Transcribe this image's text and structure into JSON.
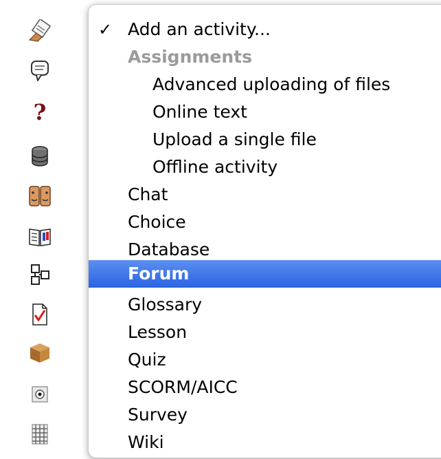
{
  "icons": [
    "assignment-icon",
    "chat-icon",
    "choice-icon",
    "database-icon",
    "forum-icon",
    "glossary-icon",
    "lesson-icon",
    "quiz-icon",
    "scorm-icon",
    "survey-icon",
    "wiki-icon"
  ],
  "menu": {
    "checkmark": "✓",
    "items": [
      {
        "label": "Add an activity..."
      },
      {
        "label": "Assignments"
      },
      {
        "label": "Advanced uploading of files"
      },
      {
        "label": "Online text"
      },
      {
        "label": "Upload a single file"
      },
      {
        "label": "Offline activity"
      },
      {
        "label": "Chat"
      },
      {
        "label": "Choice"
      },
      {
        "label": "Database"
      },
      {
        "label": "Forum"
      },
      {
        "label": "Glossary"
      },
      {
        "label": "Lesson"
      },
      {
        "label": "Quiz"
      },
      {
        "label": "SCORM/AICC"
      },
      {
        "label": "Survey"
      },
      {
        "label": "Wiki"
      }
    ]
  },
  "colors": {
    "selection": "#2a64e2",
    "header_text": "#9b9b9b"
  }
}
